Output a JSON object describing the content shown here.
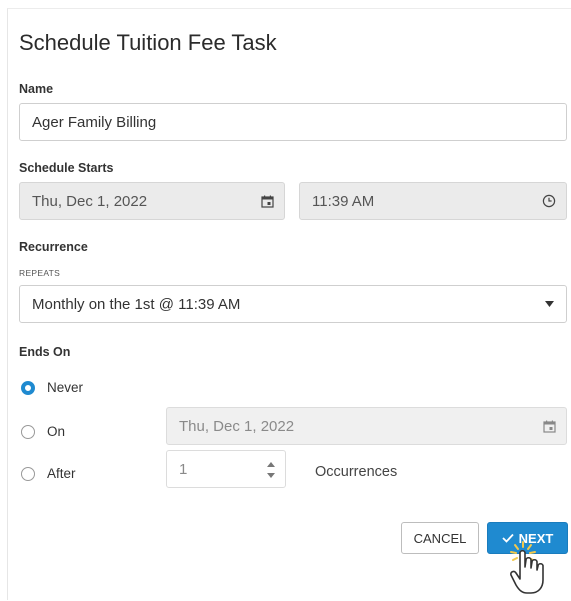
{
  "dialog": {
    "title": "Schedule Tuition Fee Task"
  },
  "name_section": {
    "label": "Name",
    "value": "Ager Family Billing"
  },
  "schedule": {
    "label": "Schedule Starts",
    "date_value": "Thu, Dec 1, 2022",
    "time_value": "11:39 AM"
  },
  "recurrence": {
    "label": "Recurrence",
    "repeats_label": "REPEATS",
    "selected": "Monthly on the 1st @ 11:39 AM"
  },
  "ends_on": {
    "label": "Ends On",
    "never_label": "Never",
    "on_label": "On",
    "on_date_placeholder": "Thu, Dec 1, 2022",
    "after_label": "After",
    "after_value": "1",
    "occurrences_label": "Occurrences",
    "selected": "Never"
  },
  "buttons": {
    "cancel": "CANCEL",
    "next": "NEXT"
  },
  "icons": {
    "calendar": "calendar-icon",
    "clock": "clock-icon",
    "dropdown": "caret-down-icon",
    "check": "check-icon",
    "cursor": "hand-pointer-icon"
  },
  "colors": {
    "accent": "#1f8ad0",
    "disabled_bg": "#ebebeb",
    "cursor_highlight": "#f2c94c"
  }
}
